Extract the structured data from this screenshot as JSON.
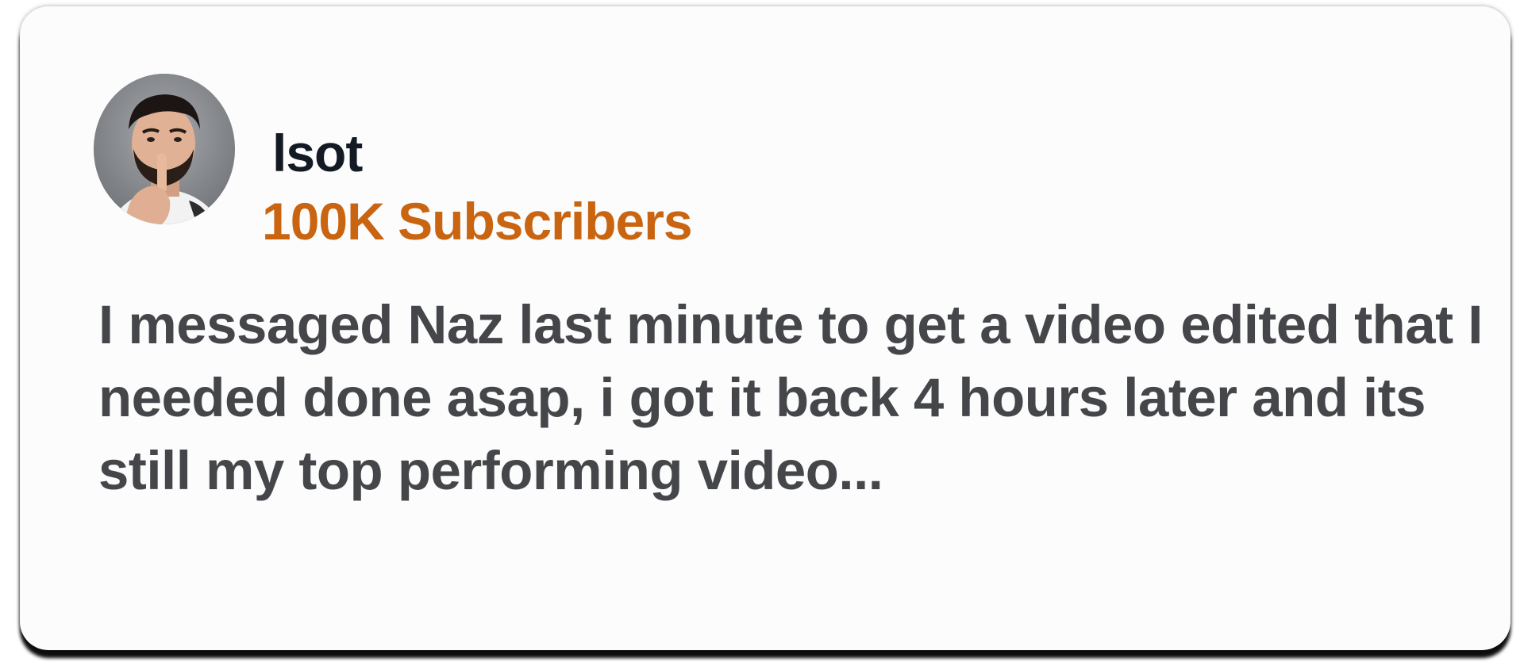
{
  "testimonial": {
    "author_name": "lsot",
    "subscriber_count": "100K Subscribers",
    "quote": "I messaged Naz last minute to get a video edited that I needed done asap, i got it back 4 hours later and its still my top performing video...",
    "avatar_icon": "avatar-photo",
    "colors": {
      "subscriber_accent": "#c96410",
      "name_text": "#141a24",
      "quote_text": "#444649",
      "card_background": "#fcfcfd"
    }
  }
}
